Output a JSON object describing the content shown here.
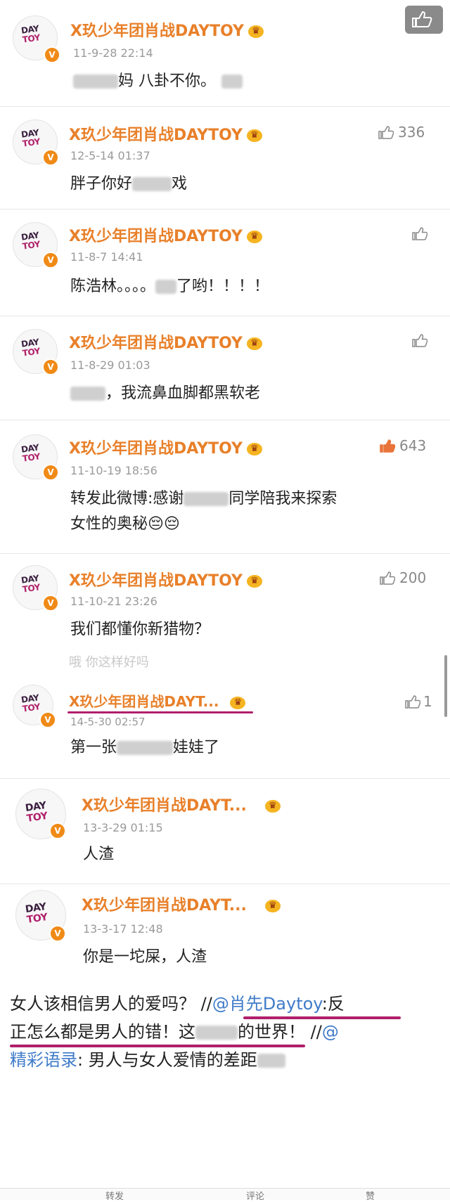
{
  "user_name": "X玖少年团肖战DAYTOY",
  "user_name_short": "X玖少年团肖战DAYT...",
  "avatar_text": [
    "DAY",
    "TOY"
  ],
  "comments": [
    {
      "time": "11-9-28 22:14",
      "text_a": "",
      "text_b": "妈  八卦不你。",
      "likes": ""
    },
    {
      "time": "12-5-14 01:37",
      "text_a": "胖子你好",
      "text_b": "戏",
      "likes": "336"
    },
    {
      "time": "11-8-7 14:41",
      "text_a": "陈浩林。。。。",
      "text_b": "了哟！！！！",
      "likes": ""
    },
    {
      "time": "11-8-29 01:03",
      "text_a": "",
      "text_b": "，我流鼻血脚都黑软老",
      "likes": ""
    },
    {
      "time": "11-10-19 18:56",
      "text_a": "转发此微博:感谢",
      "text_b": "同学陪我来探索",
      "line2": "女性的奥秘😔😔",
      "likes": "643"
    },
    {
      "time": "11-10-21 23:26",
      "text_a": "我们都懂你新猎物？",
      "text_b": "",
      "likes": "200"
    },
    {
      "time": "14-5-30 02:57",
      "text_a": "第一张",
      "text_b": "娃娃了",
      "likes": "1"
    },
    {
      "time": "13-3-29 01:15",
      "text_a": "人渣",
      "text_b": "",
      "likes": ""
    },
    {
      "time": "13-3-17 12:48",
      "text_a": "你是一坨屎，人渣",
      "text_b": "",
      "likes": ""
    }
  ],
  "ghost_text": "哦 你这样好吗",
  "weibo": {
    "line1_a": "女人该相信男人的爱吗？ //",
    "line1_mention": "@肖先Daytoy",
    "line1_b": ":反",
    "line2_a": "正怎么都是男人的错！这",
    "line2_b": "的世界！  //",
    "line2_mention": "@",
    "line3_mention": "精彩语录",
    "line3_b": ": 男人与女人爱情的差距"
  },
  "bottom": {
    "repost": "转发",
    "comment": "评论",
    "like": "赞"
  },
  "colors": {
    "name": "#e8802a",
    "mention": "#3f7bc9",
    "liked": "#e8743a",
    "underline": "#b11f6b"
  }
}
